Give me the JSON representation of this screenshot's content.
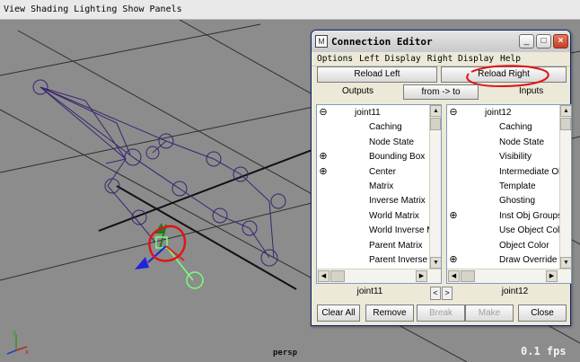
{
  "menubar": {
    "items": [
      "View",
      "Shading",
      "Lighting",
      "Show",
      "Panels"
    ]
  },
  "viewport": {
    "camera_label": "persp",
    "fps_label": "0.1 fps"
  },
  "dialog": {
    "title": "Connection Editor",
    "menu": [
      "Options",
      "Left Display",
      "Right Display",
      "Help"
    ],
    "reload_left": "Reload Left",
    "reload_right": "Reload Right",
    "outputs_label": "Outputs",
    "direction_button": "from -> to",
    "inputs_label": "Inputs",
    "left_list": [
      {
        "label": "joint11",
        "expander": "minus"
      },
      {
        "label": "Caching",
        "expander": ""
      },
      {
        "label": "Node State",
        "expander": ""
      },
      {
        "label": "Bounding Box",
        "expander": "plus"
      },
      {
        "label": "Center",
        "expander": "plus"
      },
      {
        "label": "Matrix",
        "expander": ""
      },
      {
        "label": "Inverse Matrix",
        "expander": ""
      },
      {
        "label": "World Matrix",
        "expander": ""
      },
      {
        "label": "World Inverse Ma",
        "expander": ""
      },
      {
        "label": "Parent Matrix",
        "expander": ""
      },
      {
        "label": "Parent Inverse M",
        "expander": ""
      }
    ],
    "right_list": [
      {
        "label": "joint12",
        "expander": "minus"
      },
      {
        "label": "Caching",
        "expander": ""
      },
      {
        "label": "Node State",
        "expander": ""
      },
      {
        "label": "Visibility",
        "expander": ""
      },
      {
        "label": "Intermediate Ol",
        "expander": ""
      },
      {
        "label": "Template",
        "expander": ""
      },
      {
        "label": "Ghosting",
        "expander": ""
      },
      {
        "label": "Inst Obj Groups",
        "expander": "plus"
      },
      {
        "label": "Use Object Col",
        "expander": ""
      },
      {
        "label": "Object Color",
        "expander": ""
      },
      {
        "label": "Draw Override",
        "expander": "plus"
      }
    ],
    "left_node": "joint11",
    "right_node": "joint12",
    "buttons": {
      "clear_all": "Clear All",
      "remove": "Remove",
      "break": "Break",
      "make": "Make",
      "close": "Close"
    }
  },
  "colors": {
    "viewport_bg": "#8c8c8c",
    "skeleton": "#3a2470",
    "annotation_red": "#e01515",
    "title_accent": "#0a246a"
  }
}
